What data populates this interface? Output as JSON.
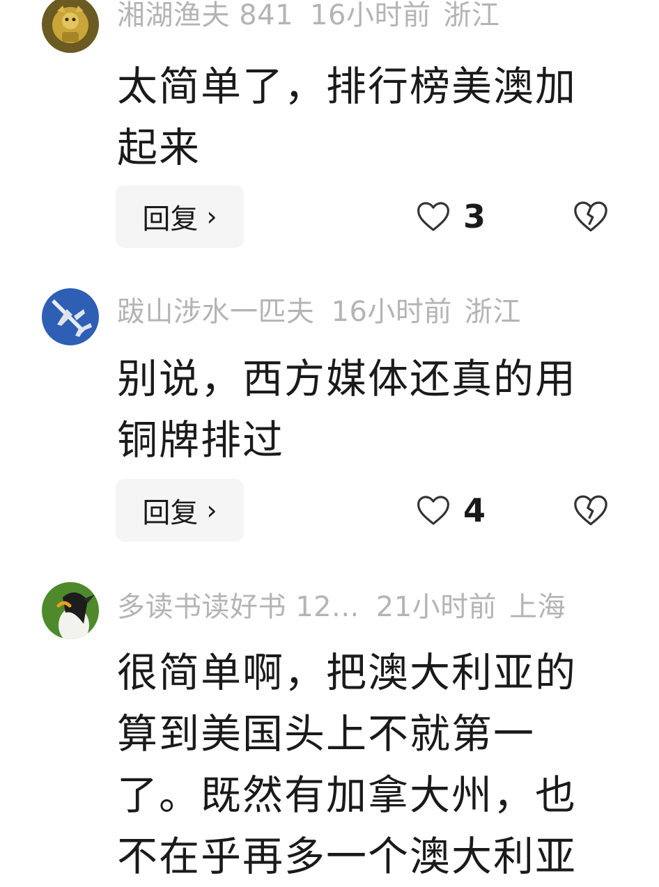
{
  "comments": [
    {
      "username": "湘湖渔夫 841",
      "time": "16小时前",
      "location": "浙江",
      "text": "太简单了，排行榜美澳加起来",
      "reply_label": "回复",
      "reply_chevron": "›",
      "likes": "3",
      "avatar_icon": "golden-figure-avatar-icon"
    },
    {
      "username": "跋山涉水一匹夫",
      "time": "16小时前",
      "location": "浙江",
      "text": "别说，西方媒体还真的用铜牌排过",
      "reply_label": "回复",
      "reply_chevron": "›",
      "likes": "4",
      "avatar_icon": "fighter-jet-avatar-icon"
    },
    {
      "username": "多读书读好书 12...",
      "time": "21小时前",
      "location": "上海",
      "text": "很简单啊，把澳大利亚的算到美国头上不就第一了。既然有加拿大州，也不在乎再多一个澳大利亚",
      "avatar_icon": "penguin-avatar-icon"
    }
  ],
  "colors": {
    "meta_text": "#b4b4b4",
    "body_text": "#1a1a1a",
    "reply_bg": "#f5f5f5",
    "icon_stroke": "#333333"
  }
}
